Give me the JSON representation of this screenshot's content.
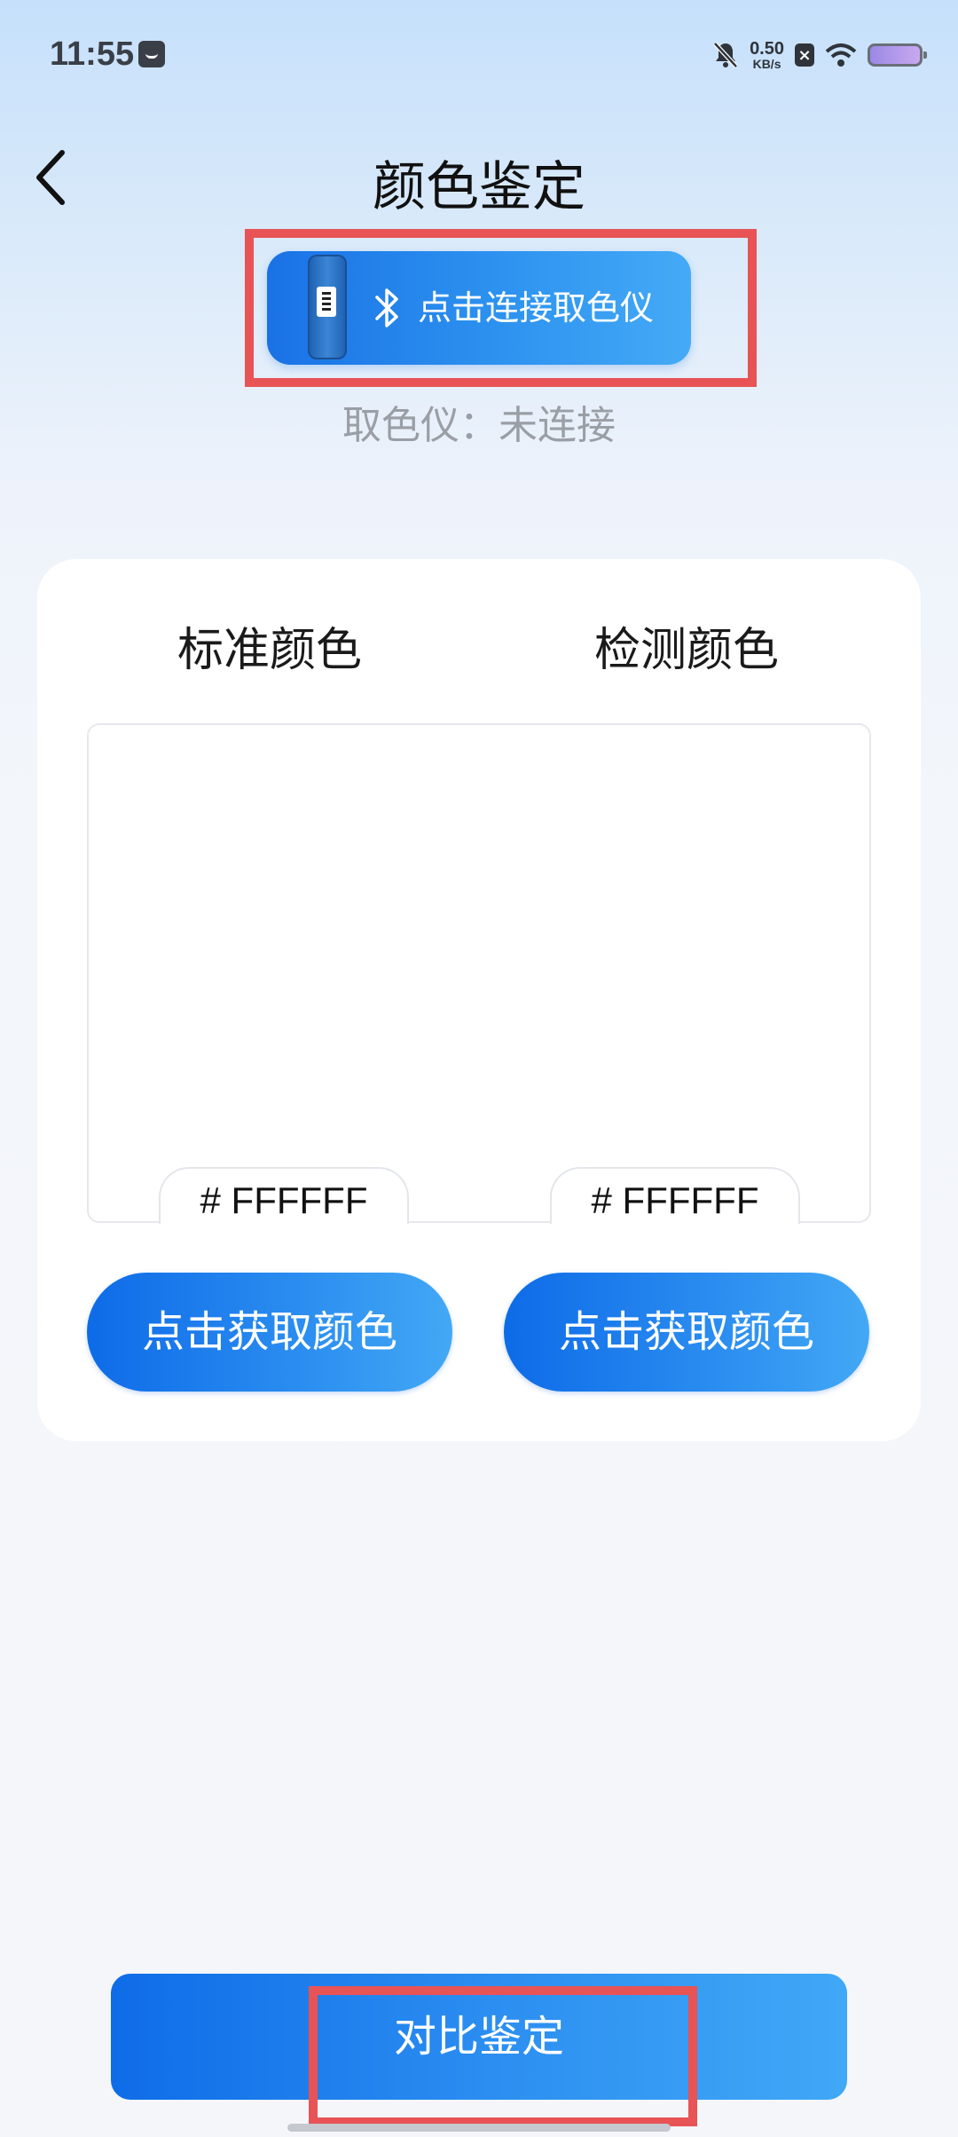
{
  "status_bar": {
    "time": "11:55",
    "net_speed_value": "0.50",
    "net_speed_unit": "KB/s",
    "icons": [
      "notification-icon",
      "mute-bell-icon",
      "sim-off-icon",
      "wifi-icon",
      "battery-icon"
    ]
  },
  "header": {
    "back_icon": "chevron-left-icon",
    "title": "颜色鉴定"
  },
  "connect": {
    "label": "点击连接取色仪",
    "icon": "bluetooth-icon",
    "status_text": "取色仪：未连接"
  },
  "colors": {
    "standard_title": "标准颜色",
    "detected_title": "检测颜色",
    "standard_hex": "# FFFFFF",
    "detected_hex": "# FFFFFF",
    "standard_color": "#FFFFFF",
    "detected_color": "#FFFFFF",
    "pick_label": "点击获取颜色"
  },
  "compare": {
    "label": "对比鉴定"
  },
  "accent_color": "#2A8AF0",
  "highlight_color": "#E85355"
}
